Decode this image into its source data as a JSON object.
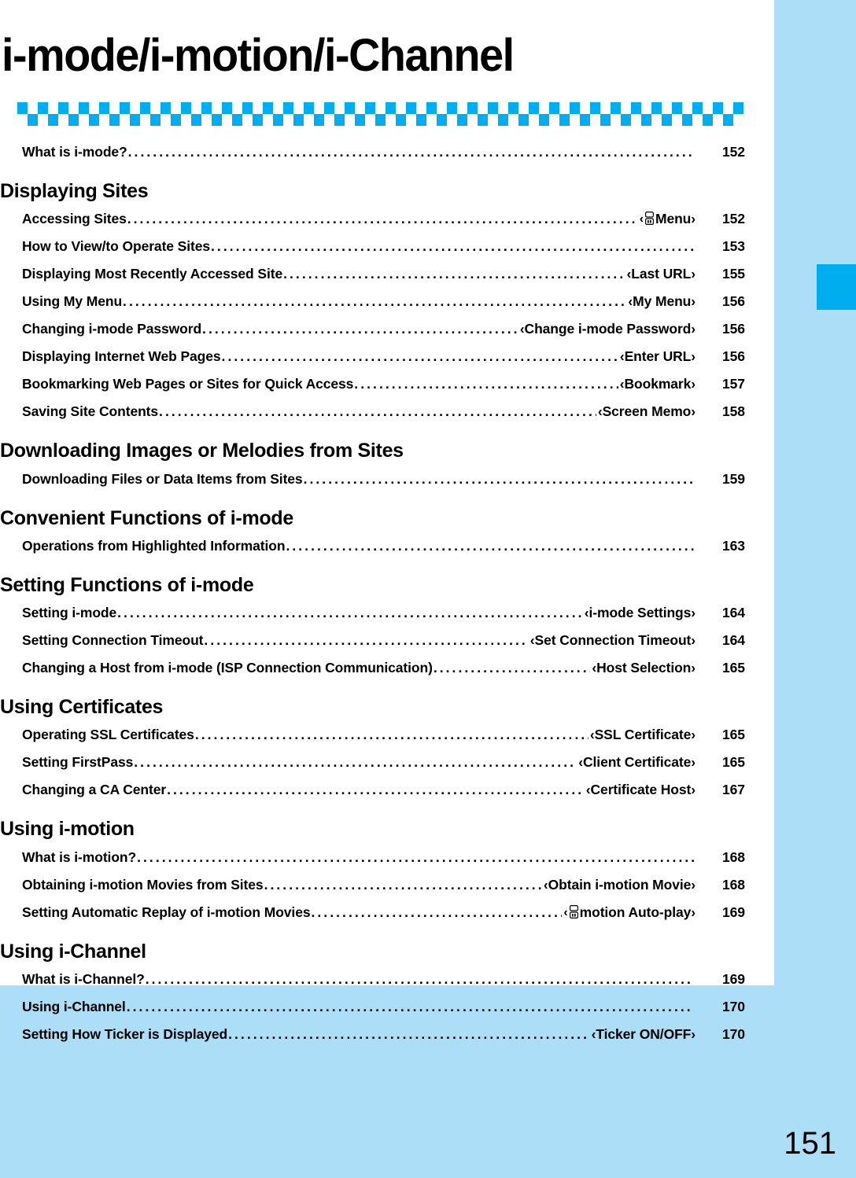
{
  "page": {
    "chapter_title": "i-mode/i-motion/i-Channel",
    "folio": "151",
    "accent_color": "#00AEEF",
    "background_color": "#ACDEF7",
    "sheet_color": "#FFFFFF"
  },
  "decoration": {
    "checker_band_name": "checkered-band",
    "checker_color": "#00AEEF",
    "checker_columns": 36,
    "edge_tab_color": "#00AEEF"
  },
  "toc": {
    "blocks": [
      {
        "heading": null,
        "entries": [
          {
            "title": "What is i-mode?",
            "ref": "",
            "page": "152"
          }
        ]
      },
      {
        "heading": "Displaying Sites",
        "entries": [
          {
            "title": "Accessing Sites",
            "ref": "‹ Menu›",
            "ref_icon": "imode-logo-icon",
            "page": "152"
          },
          {
            "title": "How to View/to Operate Sites",
            "ref": "",
            "page": "153"
          },
          {
            "title": "Displaying Most Recently Accessed Site",
            "ref": "‹Last URL›",
            "page": "155"
          },
          {
            "title": "Using My Menu",
            "ref": "‹My Menu›",
            "page": "156"
          },
          {
            "title": "Changing i-mode Password",
            "ref": "‹Change i-mode Password›",
            "page": "156"
          },
          {
            "title": "Displaying Internet Web Pages",
            "ref": "‹Enter URL›",
            "page": "156"
          },
          {
            "title": "Bookmarking Web Pages or Sites for Quick Access",
            "ref": "‹Bookmark›",
            "page": "157"
          },
          {
            "title": "Saving Site Contents",
            "ref": "‹Screen Memo›",
            "page": "158"
          }
        ]
      },
      {
        "heading": "Downloading Images or Melodies from Sites",
        "entries": [
          {
            "title": "Downloading Files or Data Items from Sites",
            "ref": "",
            "page": "159"
          }
        ]
      },
      {
        "heading": "Convenient Functions of i-mode",
        "entries": [
          {
            "title": "Operations from Highlighted Information",
            "ref": "",
            "page": "163"
          }
        ]
      },
      {
        "heading": "Setting Functions of i-mode",
        "entries": [
          {
            "title": "Setting i-mode",
            "ref": "‹i-mode Settings›",
            "page": "164"
          },
          {
            "title": "Setting Connection Timeout",
            "ref": "‹Set Connection Timeout›",
            "page": "164"
          },
          {
            "title": "Changing a Host from i-mode (ISP Connection Communication)",
            "ref": "‹Host Selection›",
            "page": "165"
          }
        ]
      },
      {
        "heading": "Using Certificates",
        "entries": [
          {
            "title": "Operating SSL Certificates",
            "ref": "‹SSL Certificate›",
            "page": "165"
          },
          {
            "title": "Setting FirstPass",
            "ref": "‹Client Certificate›",
            "page": "165"
          },
          {
            "title": "Changing a CA Center",
            "ref": "‹Certificate Host›",
            "page": "167"
          }
        ]
      },
      {
        "heading": "Using i-motion",
        "entries": [
          {
            "title": "What is i-motion?",
            "ref": "",
            "page": "168"
          },
          {
            "title": "Obtaining i-motion Movies from Sites",
            "ref": "‹Obtain i-motion Movie›",
            "page": "168"
          },
          {
            "title": "Setting Automatic Replay of i-motion Movies",
            "ref": "‹ motion Auto-play›",
            "ref_icon": "imode-logo-icon",
            "page": "169"
          }
        ]
      },
      {
        "heading": "Using i-Channel",
        "entries": [
          {
            "title": "What is i-Channel?",
            "ref": "",
            "page": "169"
          },
          {
            "title": "Using i-Channel",
            "ref": "",
            "page": "170"
          },
          {
            "title": "Setting How Ticker is Displayed",
            "ref": "‹Ticker ON/OFF›",
            "page": "170"
          }
        ]
      }
    ]
  }
}
